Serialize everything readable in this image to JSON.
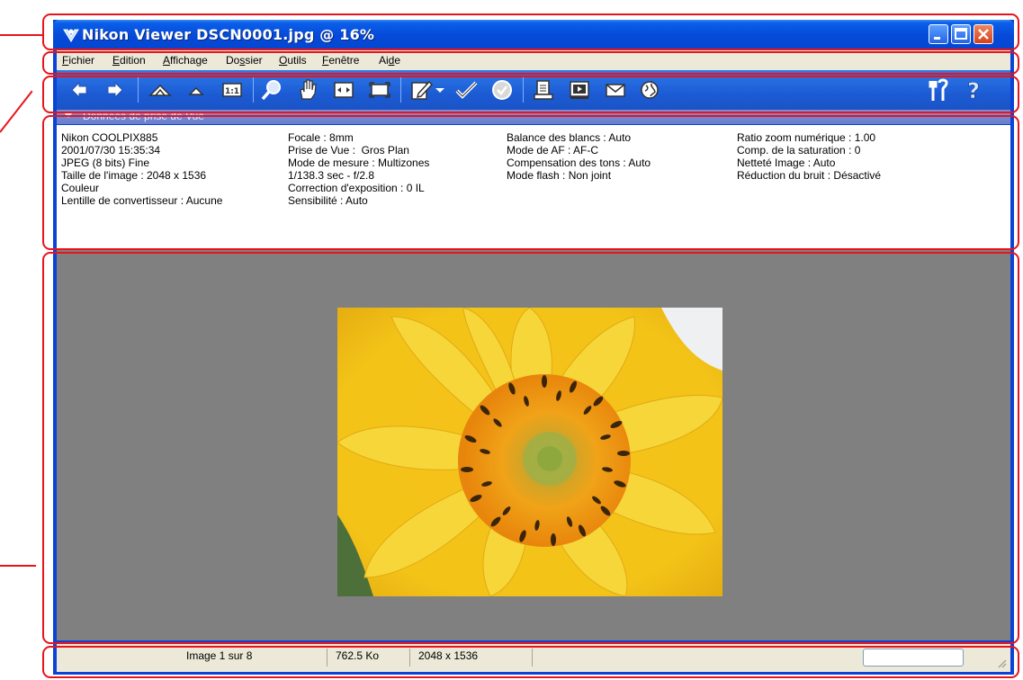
{
  "window": {
    "title": "Nikon Viewer DSCN0001.jpg @ 16%"
  },
  "menu": [
    {
      "label": "Fichier",
      "key": "F"
    },
    {
      "label": "Edition",
      "key": "E"
    },
    {
      "label": "Affichage",
      "key": "A"
    },
    {
      "label": "Dossier",
      "key": "s"
    },
    {
      "label": "Outils",
      "key": "O"
    },
    {
      "label": "Fenêtre",
      "key": "F"
    },
    {
      "label": "Aide",
      "key": "d"
    }
  ],
  "toolbar": {
    "buttons": [
      "previous-icon",
      "next-icon",
      "zoom-in-icon",
      "zoom-out-icon",
      "actual-size-icon",
      "magnifier-icon",
      "hand-icon",
      "fit-window-icon",
      "full-screen-icon",
      "edit-icon",
      "dropdown-icon",
      "check-icon",
      "protect-icon",
      "print-icon",
      "slideshow-icon",
      "email-icon",
      "web-icon",
      "settings-icon",
      "help-icon"
    ]
  },
  "metadata": {
    "header": "Données de prise de Vue",
    "columns": [
      [
        "Nikon COOLPIX885",
        "2001/07/30 15:35:34",
        "JPEG (8 bits) Fine",
        "Taille de l'image : 2048 x 1536",
        "Couleur",
        "Lentille de convertisseur : Aucune"
      ],
      [
        "Focale : 8mm",
        "Prise de Vue :  Gros Plan",
        "Mode de mesure : Multizones",
        "1/138.3 sec - f/2.8",
        "Correction d'exposition : 0 IL",
        "Sensibilité : Auto"
      ],
      [
        "Balance des blancs : Auto",
        "Mode de AF : AF-C",
        "Compensation des tons : Auto",
        "Mode flash : Non joint"
      ],
      [
        "Ratio zoom numérique : 1.00",
        "Comp. de la saturation : 0",
        "Netteté Image : Auto",
        "Réduction du bruit : Désactivé"
      ]
    ]
  },
  "status": {
    "image_position": "Image 1 sur 8",
    "file_size": "762.5 Ko",
    "dimensions": "2048 x 1536"
  },
  "colors": {
    "callout": "#e8141c",
    "titlebar": "#0648d8",
    "viewer_bg": "#808080"
  }
}
